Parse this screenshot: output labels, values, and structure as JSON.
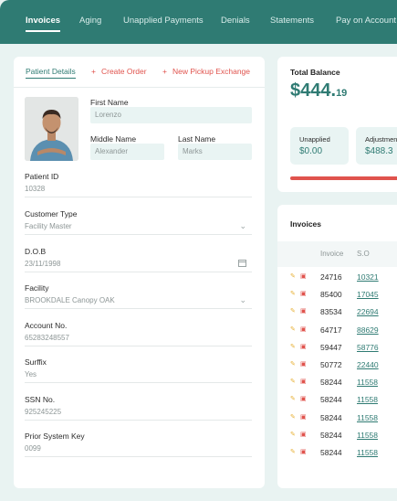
{
  "topnav": {
    "tabs": [
      {
        "label": "Invoices",
        "active": true
      },
      {
        "label": "Aging"
      },
      {
        "label": "Unapplied Payments"
      },
      {
        "label": "Denials"
      },
      {
        "label": "Statements"
      },
      {
        "label": "Pay on Account"
      }
    ]
  },
  "patient_panel": {
    "tabs": {
      "details": "Patient Details",
      "create_order": "Create Order",
      "new_pickup": "New Pickup Exchange"
    },
    "first_name": {
      "label": "First Name",
      "value": "Lorenzo"
    },
    "middle_name": {
      "label": "Middle Name",
      "placeholder": "Alexander"
    },
    "last_name": {
      "label": "Last Name",
      "placeholder": "Marks"
    },
    "patient_id": {
      "label": "Patient ID",
      "value": "10328"
    },
    "customer_type": {
      "label": "Customer Type",
      "value": "Facility Master"
    },
    "dob": {
      "label": "D.O.B",
      "value": "23/11/1998"
    },
    "facility": {
      "label": "Facility",
      "value": "BROOKDALE Canopy OAK"
    },
    "account_no": {
      "label": "Account No.",
      "value": "65283248557"
    },
    "suffix": {
      "label": "Surffix",
      "value": "Yes"
    },
    "ssn": {
      "label": "SSN No.",
      "value": "925245225"
    },
    "prior_key": {
      "label": "Prior System Key",
      "value": "0099"
    }
  },
  "balance": {
    "title": "Total Balance",
    "amount_main": "$444.",
    "amount_cents": "19",
    "unapplied": {
      "label": "Unapplied",
      "value": "$0.00"
    },
    "adjustment": {
      "label": "Adjustmen",
      "value": "$488.3"
    },
    "accent_color": "#e0534d"
  },
  "invoices": {
    "title": "Invoices",
    "columns": {
      "invoice": "Invoice",
      "so": "S.O"
    },
    "rows": [
      {
        "invoice": "24716",
        "so": "10321"
      },
      {
        "invoice": "85400",
        "so": "17045"
      },
      {
        "invoice": "83534",
        "so": "22694"
      },
      {
        "invoice": "64717",
        "so": "88629"
      },
      {
        "invoice": "59447",
        "so": "58776"
      },
      {
        "invoice": "50772",
        "so": "22440"
      },
      {
        "invoice": "58244",
        "so": "11558"
      },
      {
        "invoice": "58244",
        "so": "11558"
      },
      {
        "invoice": "58244",
        "so": "11558"
      },
      {
        "invoice": "58244",
        "so": "11558"
      },
      {
        "invoice": "58244",
        "so": "11558"
      }
    ]
  },
  "colors": {
    "brand": "#2f7b73",
    "link": "#e0534d",
    "field_bg": "#e9f4f3"
  }
}
